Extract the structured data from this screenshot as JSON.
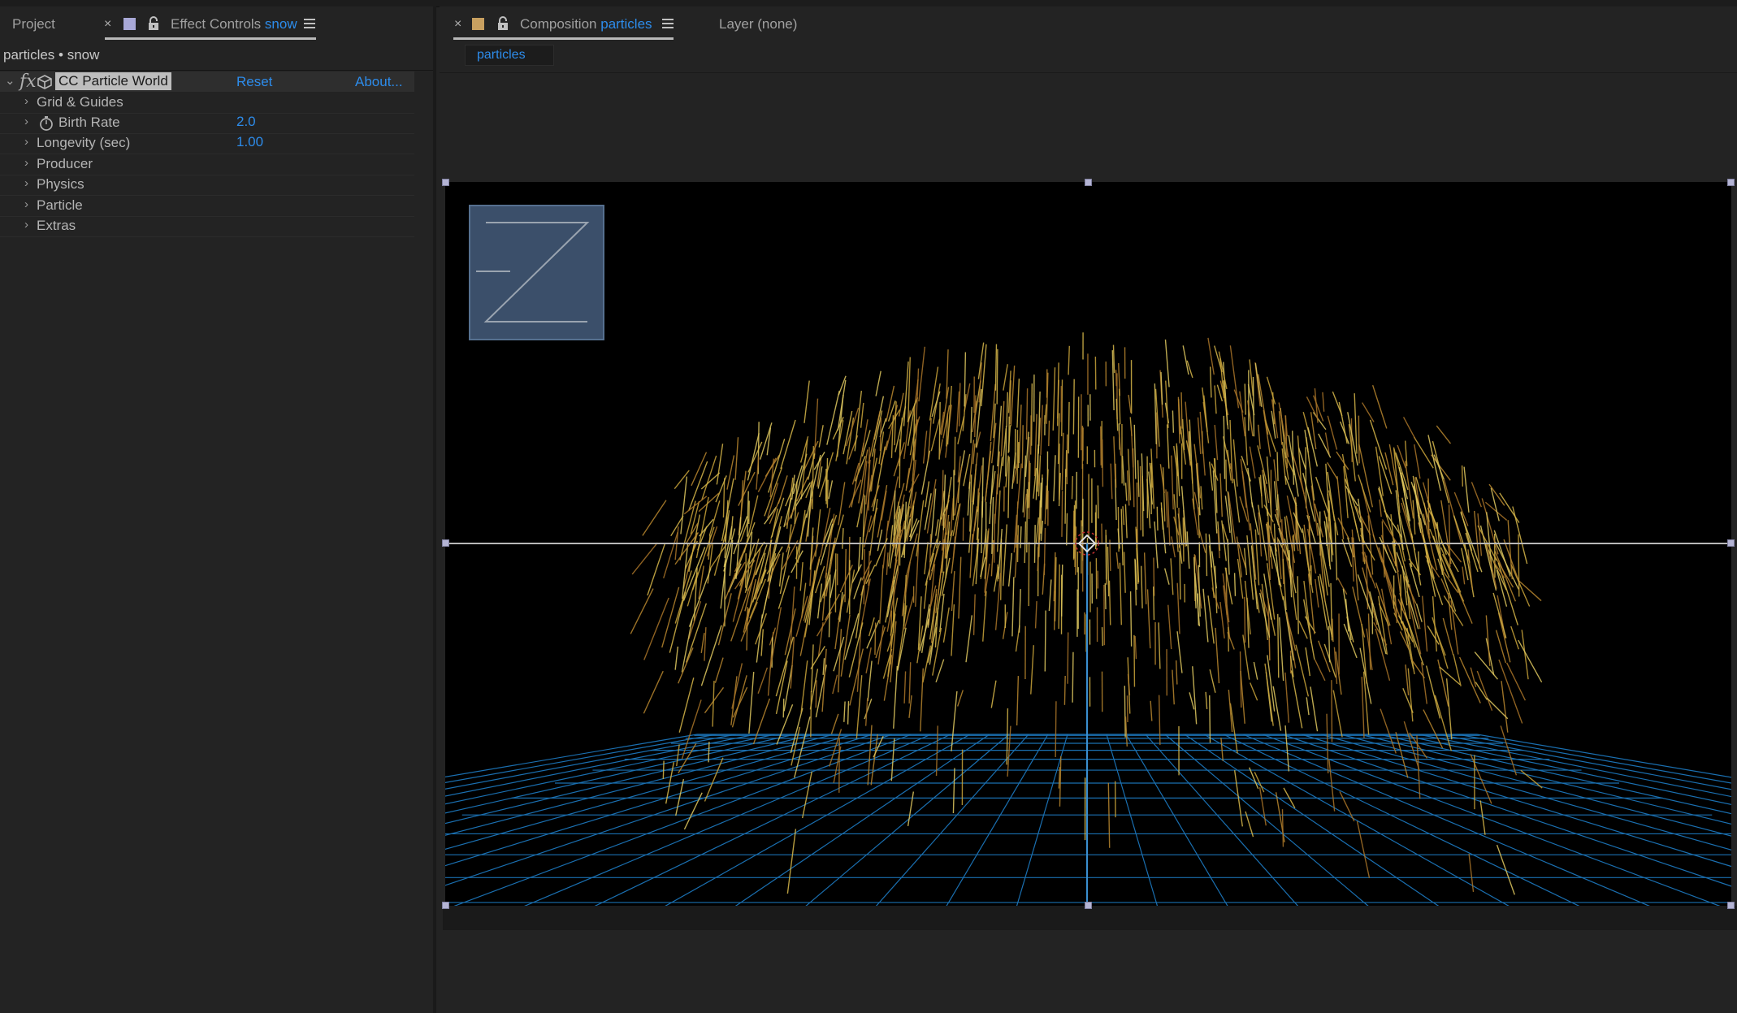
{
  "left_panel": {
    "tabs": {
      "project": "Project",
      "effect_controls": "Effect Controls",
      "effect_controls_target": "snow"
    },
    "breadcrumb": "particles • snow",
    "effect": {
      "name": "CC Particle World",
      "reset": "Reset",
      "about": "About...",
      "properties": [
        {
          "label": "Grid & Guides",
          "value": ""
        },
        {
          "label": "Birth Rate",
          "value": "2.0"
        },
        {
          "label": "Longevity (sec)",
          "value": "1.00"
        },
        {
          "label": "Producer",
          "value": ""
        },
        {
          "label": "Physics",
          "value": ""
        },
        {
          "label": "Particle",
          "value": ""
        },
        {
          "label": "Extras",
          "value": ""
        }
      ]
    }
  },
  "right_panel": {
    "tabs": {
      "composition": "Composition",
      "composition_name": "particles",
      "layer": "Layer",
      "layer_value": "(none)"
    },
    "viewer_tab": "particles"
  },
  "colors": {
    "accent": "#2d8ceb",
    "panel_bg": "#232323",
    "particle": "#c9a43a",
    "grid": "#1a6fb0"
  },
  "icons": [
    "close-icon",
    "color-swatch-icon",
    "lock-icon",
    "panel-menu-icon",
    "fx-icon",
    "3d-cube-icon",
    "chevron-right-icon",
    "stopwatch-icon",
    "z-axis-icon"
  ]
}
